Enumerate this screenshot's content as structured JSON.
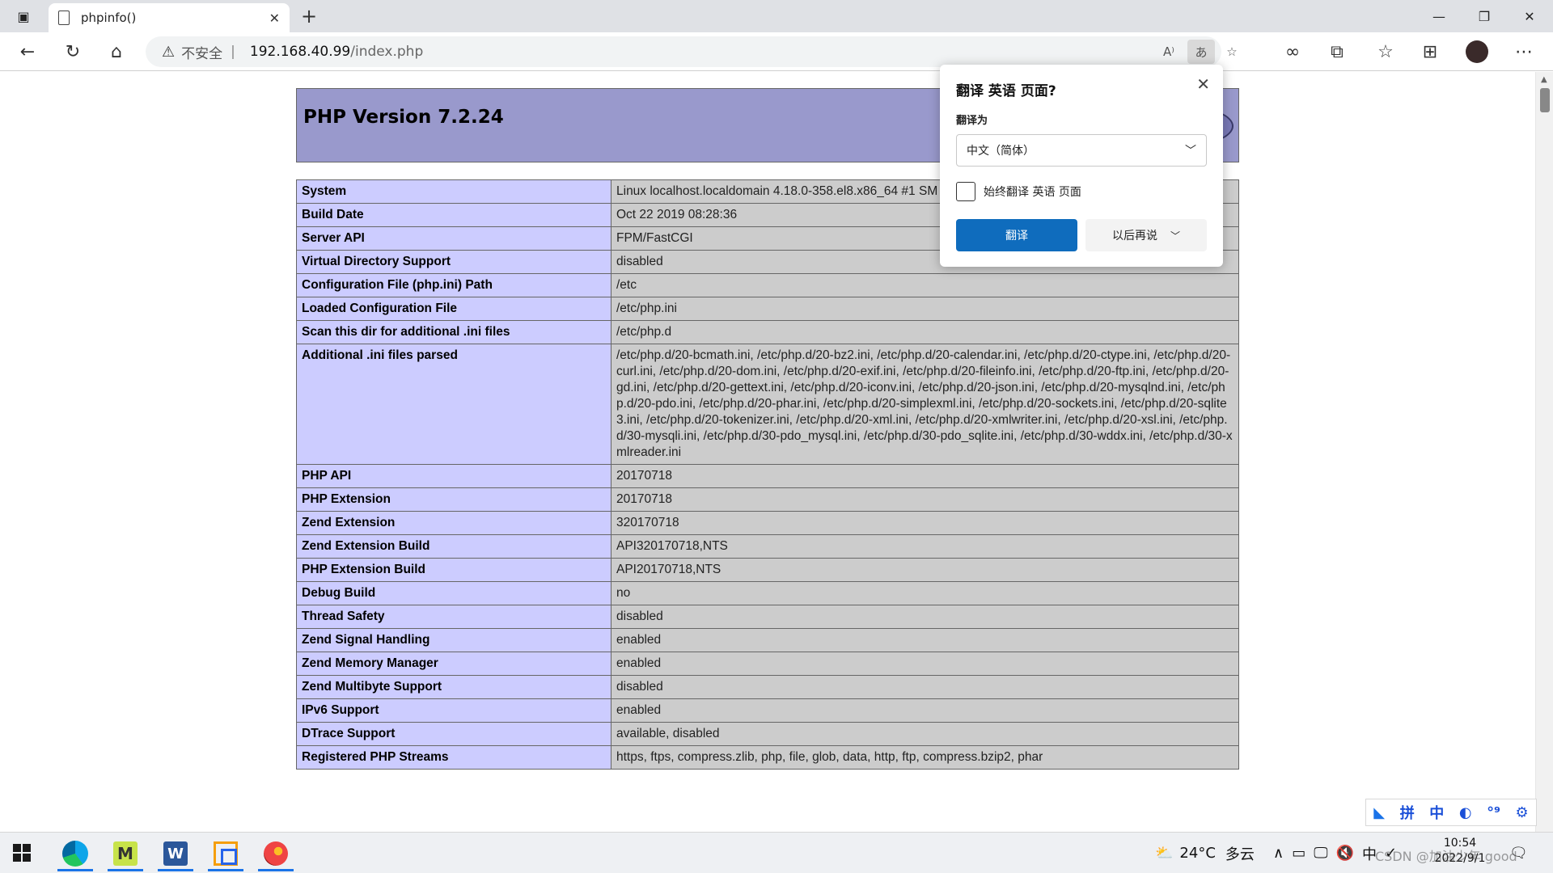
{
  "browser": {
    "tab_title": "phpinfo()",
    "address": {
      "insecure_label": "不安全",
      "separator": "|",
      "host": "192.168.40.99",
      "path": "/index.php"
    },
    "icons": {
      "tab_actions": "tab-actions-icon",
      "back": "back-arrow-icon",
      "refresh": "refresh-icon",
      "home": "home-icon",
      "warning": "warning-icon",
      "read_aloud": "read-aloud-icon",
      "translate": "translate-icon",
      "favorite": "add-favorite-icon",
      "infinity": "infinity-icon",
      "extensions": "extensions-icon",
      "favorites": "favorites-icon",
      "collections": "collections-icon",
      "profile": "profile-avatar",
      "more": "more-icon"
    }
  },
  "php": {
    "version_title": "PHP Version 7.2.24",
    "rows": [
      {
        "key": "System",
        "value": "Linux localhost.localdomain 4.18.0-358.el8.x86_64 #1 SM"
      },
      {
        "key": "Build Date",
        "value": "Oct 22 2019 08:28:36"
      },
      {
        "key": "Server API",
        "value": "FPM/FastCGI"
      },
      {
        "key": "Virtual Directory Support",
        "value": "disabled"
      },
      {
        "key": "Configuration File (php.ini) Path",
        "value": "/etc"
      },
      {
        "key": "Loaded Configuration File",
        "value": "/etc/php.ini"
      },
      {
        "key": "Scan this dir for additional .ini files",
        "value": "/etc/php.d"
      },
      {
        "key": "Additional .ini files parsed",
        "value": "/etc/php.d/20-bcmath.ini, /etc/php.d/20-bz2.ini, /etc/php.d/20-calendar.ini, /etc/php.d/20-ctype.ini, /etc/php.d/20-curl.ini, /etc/php.d/20-dom.ini, /etc/php.d/20-exif.ini, /etc/php.d/20-fileinfo.ini, /etc/php.d/20-ftp.ini, /etc/php.d/20-gd.ini, /etc/php.d/20-gettext.ini, /etc/php.d/20-iconv.ini, /etc/php.d/20-json.ini, /etc/php.d/20-mysqlnd.ini, /etc/php.d/20-pdo.ini, /etc/php.d/20-phar.ini, /etc/php.d/20-simplexml.ini, /etc/php.d/20-sockets.ini, /etc/php.d/20-sqlite3.ini, /etc/php.d/20-tokenizer.ini, /etc/php.d/20-xml.ini, /etc/php.d/20-xmlwriter.ini, /etc/php.d/20-xsl.ini, /etc/php.d/30-mysqli.ini, /etc/php.d/30-pdo_mysql.ini, /etc/php.d/30-pdo_sqlite.ini, /etc/php.d/30-wddx.ini, /etc/php.d/30-xmlreader.ini"
      },
      {
        "key": "PHP API",
        "value": "20170718"
      },
      {
        "key": "PHP Extension",
        "value": "20170718"
      },
      {
        "key": "Zend Extension",
        "value": "320170718"
      },
      {
        "key": "Zend Extension Build",
        "value": "API320170718,NTS"
      },
      {
        "key": "PHP Extension Build",
        "value": "API20170718,NTS"
      },
      {
        "key": "Debug Build",
        "value": "no"
      },
      {
        "key": "Thread Safety",
        "value": "disabled"
      },
      {
        "key": "Zend Signal Handling",
        "value": "enabled"
      },
      {
        "key": "Zend Memory Manager",
        "value": "enabled"
      },
      {
        "key": "Zend Multibyte Support",
        "value": "disabled"
      },
      {
        "key": "IPv6 Support",
        "value": "enabled"
      },
      {
        "key": "DTrace Support",
        "value": "available, disabled"
      },
      {
        "key": "Registered PHP Streams",
        "value": "https, ftps, compress.zlib, php, file, glob, data, http, ftp, compress.bzip2, phar"
      }
    ]
  },
  "translate_popup": {
    "title": "翻译 英语 页面?",
    "target_label": "翻译为",
    "target_value": "中文（简体）",
    "always_label": "始终翻译 英语 页面",
    "translate_button": "翻译",
    "later_button": "以后再说"
  },
  "ime": {
    "items": [
      "拼",
      "中",
      "◐",
      "°⁹",
      "⚙"
    ]
  },
  "taskbar": {
    "weather_temp": "24°C",
    "weather_desc": "多云",
    "time": "10:54",
    "date": "2022/9/1",
    "watermark": "CSDN @加油少年 good"
  }
}
